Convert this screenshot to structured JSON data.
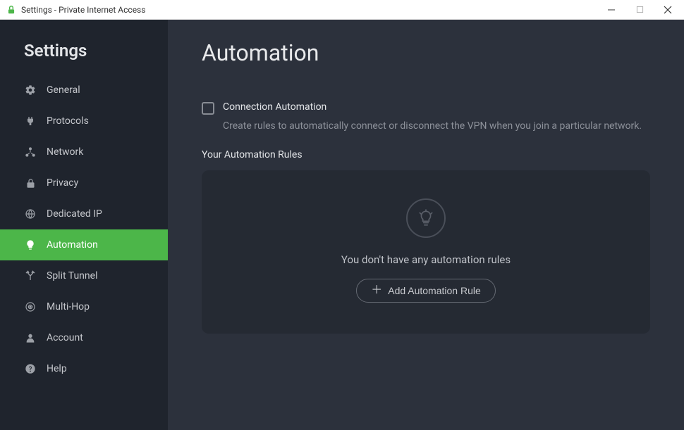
{
  "titlebar": {
    "title": "Settings - Private Internet Access"
  },
  "sidebar": {
    "heading": "Settings",
    "items": [
      {
        "label": "General"
      },
      {
        "label": "Protocols"
      },
      {
        "label": "Network"
      },
      {
        "label": "Privacy"
      },
      {
        "label": "Dedicated IP"
      },
      {
        "label": "Automation"
      },
      {
        "label": "Split Tunnel"
      },
      {
        "label": "Multi-Hop"
      },
      {
        "label": "Account"
      },
      {
        "label": "Help"
      }
    ]
  },
  "main": {
    "title": "Automation",
    "connection_automation": {
      "label": "Connection Automation",
      "description": "Create rules to automatically connect or disconnect the VPN when you join a particular network."
    },
    "rules_heading": "Your Automation Rules",
    "empty_text": "You don't have any automation rules",
    "add_rule_label": "Add Automation Rule"
  }
}
